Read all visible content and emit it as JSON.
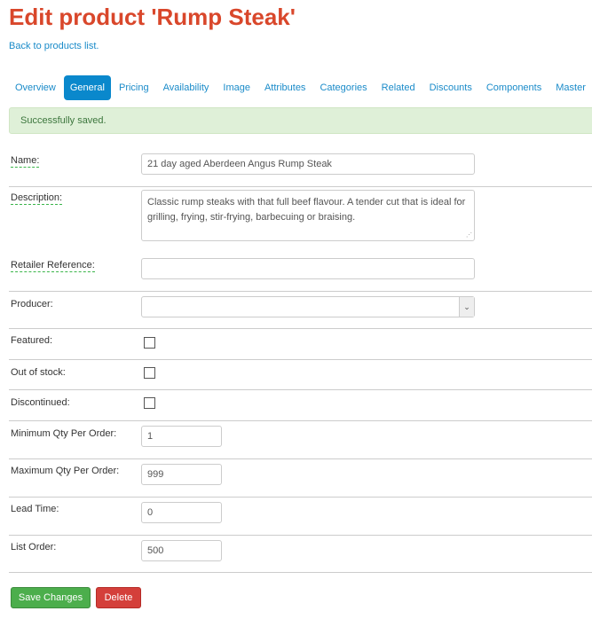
{
  "header": {
    "title": "Edit product 'Rump Steak'",
    "back_link": "Back to products list."
  },
  "tabs": [
    {
      "label": "Overview"
    },
    {
      "label": "General",
      "active": true
    },
    {
      "label": "Pricing"
    },
    {
      "label": "Availability"
    },
    {
      "label": "Image"
    },
    {
      "label": "Attributes"
    },
    {
      "label": "Categories"
    },
    {
      "label": "Related"
    },
    {
      "label": "Discounts"
    },
    {
      "label": "Components"
    },
    {
      "label": "Master"
    }
  ],
  "alert": {
    "message": "Successfully saved."
  },
  "form": {
    "name": {
      "label": "Name:",
      "value": "21 day aged Aberdeen Angus Rump Steak"
    },
    "description": {
      "label": "Description:",
      "value": "Classic rump steaks with that full beef flavour. A tender cut that is ideal for grilling, frying, stir-frying, barbecuing or braising."
    },
    "retailer_reference": {
      "label": "Retailer Reference:",
      "value": ""
    },
    "producer": {
      "label": "Producer:",
      "value": ""
    },
    "featured": {
      "label": "Featured:",
      "checked": false
    },
    "out_of_stock": {
      "label": "Out of stock:",
      "checked": false
    },
    "discontinued": {
      "label": "Discontinued:",
      "checked": false
    },
    "min_qty": {
      "label": "Minimum Qty Per Order:",
      "value": "1"
    },
    "max_qty": {
      "label": "Maximum Qty Per Order:",
      "value": "999"
    },
    "lead_time": {
      "label": "Lead Time:",
      "value": "0"
    },
    "list_order": {
      "label": "List Order:",
      "value": "500"
    }
  },
  "buttons": {
    "save": "Save Changes",
    "delete": "Delete"
  },
  "colors": {
    "title": "#d9472b",
    "link": "#1a8bc9",
    "active_tab": "#0a88cc",
    "success_bg": "#dff0d8",
    "save": "#4cae4c",
    "delete": "#d43f3a"
  }
}
